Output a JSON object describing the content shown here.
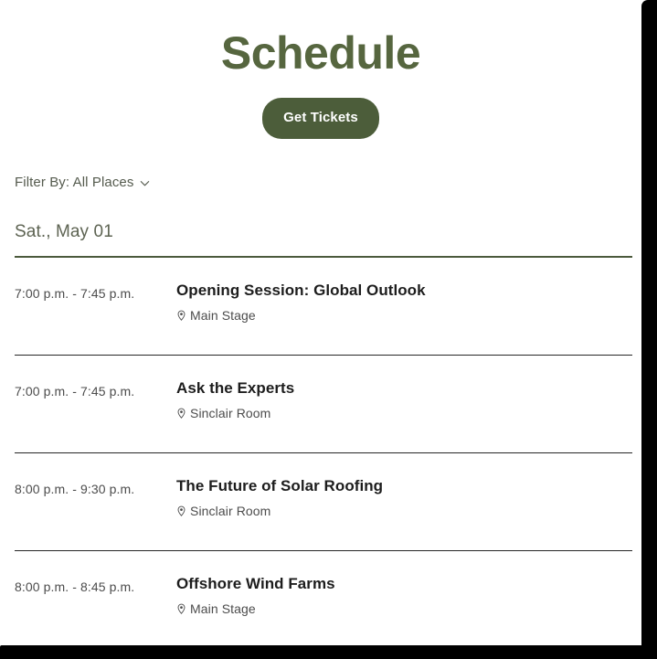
{
  "page": {
    "title": "Schedule",
    "title_color": "#56663F"
  },
  "cta": {
    "label": "Get Tickets",
    "background_color": "#4C5D3A",
    "text_color": "#FFFFFF"
  },
  "filter": {
    "label": "Filter By: All Places",
    "icon": "chevron-down-icon"
  },
  "day": {
    "heading": "Sat., May 01",
    "rule_color": "#4B5A3C"
  },
  "sessions": [
    {
      "time": "7:00 p.m. - 7:45 p.m.",
      "title": "Opening Session: Global Outlook",
      "place": "Main Stage",
      "place_icon": "location-pin-icon"
    },
    {
      "time": "7:00 p.m. - 7:45 p.m.",
      "title": "Ask the Experts",
      "place": "Sinclair Room",
      "place_icon": "location-pin-icon"
    },
    {
      "time": "8:00 p.m. - 9:30 p.m.",
      "title": "The Future of Solar Roofing",
      "place": "Sinclair Room",
      "place_icon": "location-pin-icon"
    },
    {
      "time": "8:00 p.m. - 8:45 p.m.",
      "title": "Offshore Wind Farms",
      "place": "Main Stage",
      "place_icon": "location-pin-icon"
    }
  ]
}
